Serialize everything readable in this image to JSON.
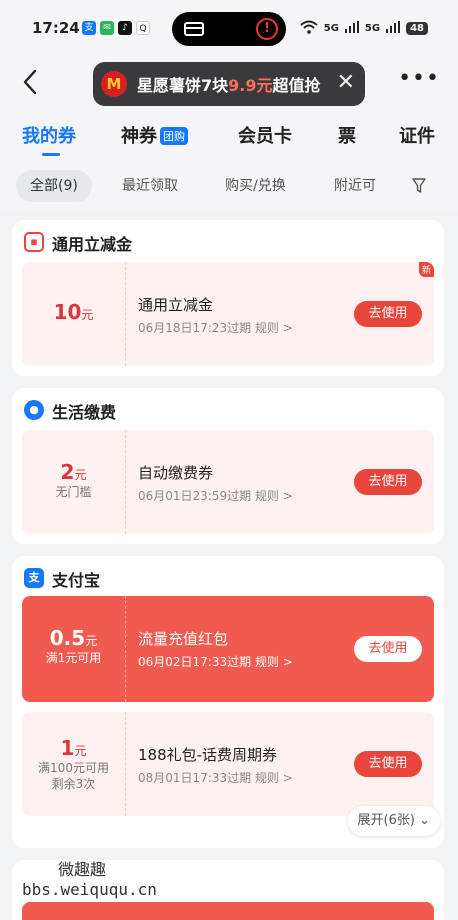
{
  "status": {
    "time": "17:24",
    "network1": "5G",
    "network2": "5G",
    "battery": "48"
  },
  "header": {
    "toast_text": "星愿薯饼7块",
    "toast_price": "9.9元",
    "toast_suffix": "超值抢",
    "toast_logo": "M"
  },
  "tabs": [
    {
      "label": "我的券"
    },
    {
      "label": "神券",
      "tag": "团购"
    },
    {
      "label": "会员卡"
    },
    {
      "label": "票"
    },
    {
      "label": "证件"
    }
  ],
  "filters": [
    {
      "label": "全部(9)"
    },
    {
      "label": "最近领取"
    },
    {
      "label": "购买/兑换"
    },
    {
      "label": "附近可"
    }
  ],
  "sections": [
    {
      "title": "通用立减金",
      "coupons": [
        {
          "amount": "10",
          "unit": "元",
          "cond": "",
          "name": "通用立减金",
          "meta": "06月18日17:23过期  规则 >",
          "button": "去使用",
          "badge": "新"
        }
      ]
    },
    {
      "title": "生活缴费",
      "coupons": [
        {
          "amount": "2",
          "unit": "元",
          "cond": "无门槛",
          "name": "自动缴费券",
          "meta": "06月01日23:59过期  规则 >",
          "button": "去使用"
        }
      ]
    },
    {
      "title": "支付宝",
      "coupons": [
        {
          "amount": "0.5",
          "unit": "元",
          "cond": "满1元可用",
          "name": "流量充值红包",
          "meta": "06月02日17:33过期  规则 >",
          "button": "去使用"
        },
        {
          "amount": "1",
          "unit": "元",
          "cond": "满100元可用",
          "cond2": "剩余3次",
          "name": "188礼包-话费周期券",
          "meta": "08月01日17:33过期  规则 >",
          "button": "去使用"
        }
      ],
      "expand": "展开(6张)"
    }
  ],
  "watermark": {
    "line1": "微趣趣",
    "line2": "bbs.weiququ.cn"
  },
  "colors": {
    "accent": "#1677ff",
    "coupon_red": "#f15a4f",
    "button_red": "#e8453c"
  }
}
